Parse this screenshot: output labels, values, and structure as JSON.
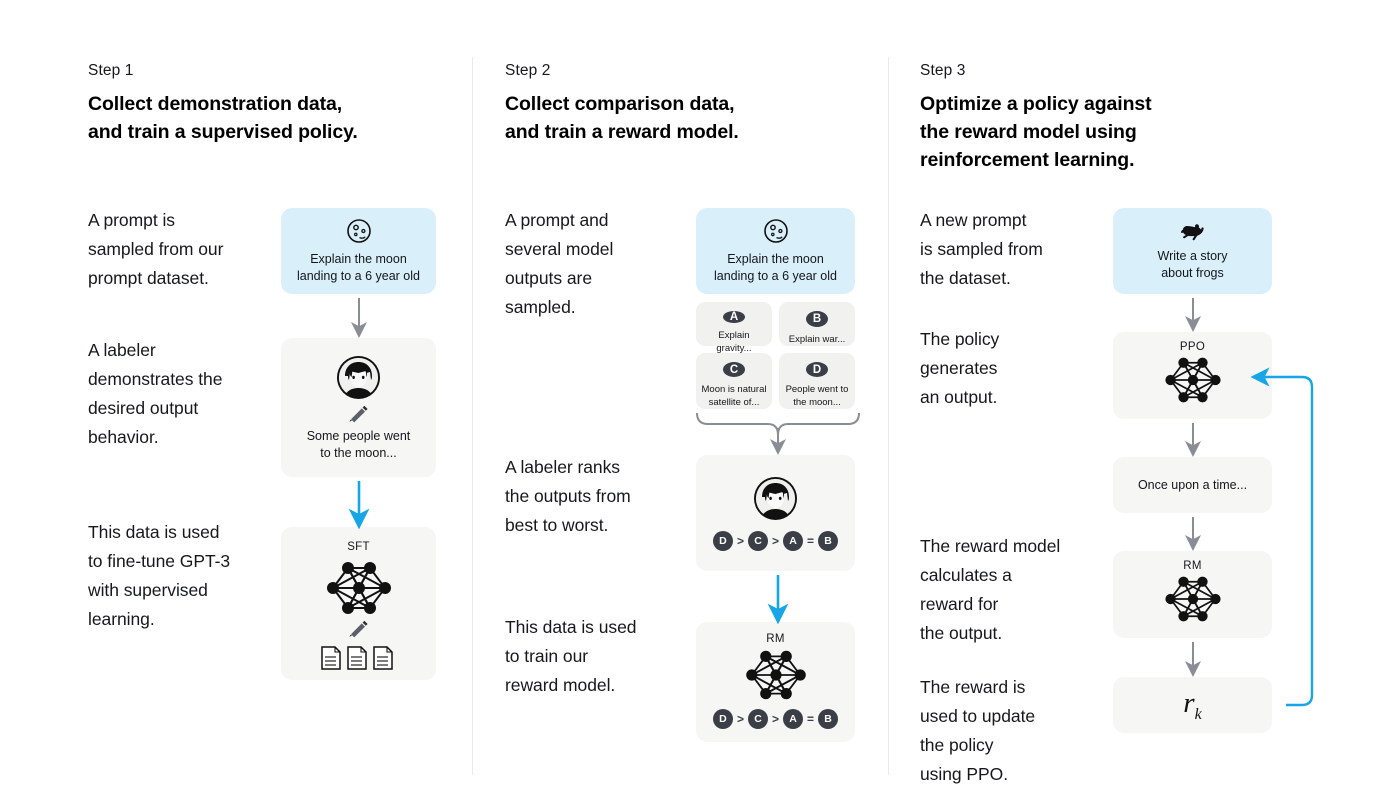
{
  "steps": [
    {
      "label": "Step 1",
      "title": "Collect demonstration data,\nand train a supervised policy.",
      "paragraphs": [
        "A prompt is\nsampled from our\nprompt dataset.",
        "A labeler\ndemonstrates the\ndesired output\nbehavior.",
        "This data is used\nto fine-tune GPT-3\nwith supervised\nlearning."
      ],
      "cards": {
        "prompt": {
          "icon": "moon-icon",
          "text": "Explain the moon\nlanding to a 6 year old"
        },
        "labeler": {
          "icon": "labeler-avatar-icon",
          "pencil": "pencil-icon",
          "text": "Some people went\nto the moon..."
        },
        "sft": {
          "label": "SFT",
          "network": "neural-network-icon",
          "pencil": "pencil-icon",
          "docs": "documents-icon"
        }
      }
    },
    {
      "label": "Step 2",
      "title": "Collect comparison data,\nand train a reward model.",
      "paragraphs": [
        "A prompt and\nseveral model\noutputs are\nsampled.",
        "A labeler ranks\nthe outputs from\nbest to worst.",
        "This data is used\nto train our\nreward model."
      ],
      "cards": {
        "prompt": {
          "icon": "moon-icon",
          "text": "Explain the moon\nlanding to a 6 year old"
        },
        "outputs": [
          {
            "badge": "A",
            "text": "Explain gravity..."
          },
          {
            "badge": "B",
            "text": "Explain war..."
          },
          {
            "badge": "C",
            "text": "Moon is natural\nsatellite of..."
          },
          {
            "badge": "D",
            "text": "People went to\nthe moon..."
          }
        ],
        "ranking": {
          "icon": "labeler-avatar-icon",
          "order": [
            "D",
            ">",
            "C",
            ">",
            "A",
            "=",
            "B"
          ]
        },
        "rm": {
          "label": "RM",
          "network": "neural-network-icon",
          "order": [
            "D",
            ">",
            "C",
            ">",
            "A",
            "=",
            "B"
          ]
        }
      }
    },
    {
      "label": "Step 3",
      "title": "Optimize a policy against\nthe reward model using\nreinforcement learning.",
      "paragraphs": [
        "A new prompt\nis sampled from\nthe dataset.",
        "The policy\ngenerates\nan output.",
        "The reward model\ncalculates a\nreward for\nthe output.",
        "The reward is\nused to update\nthe policy\nusing PPO."
      ],
      "cards": {
        "prompt": {
          "icon": "frog-icon",
          "text": "Write a story\nabout frogs"
        },
        "ppo": {
          "label": "PPO",
          "network": "neural-network-icon"
        },
        "output": {
          "text": "Once upon a time..."
        },
        "rm": {
          "label": "RM",
          "network": "neural-network-icon"
        },
        "reward": {
          "symbol": "r",
          "subscript": "k"
        }
      }
    }
  ],
  "colors": {
    "prompt_card": "#d9f0fb",
    "neutral_card": "#f6f6f5",
    "mini_card": "#f1f1f0",
    "badge": "#3a3f47",
    "gray_arrow": "#8a8d96",
    "blue_arrow": "#16a6e8",
    "divider": "#e9eaec",
    "text": "#16181c"
  }
}
